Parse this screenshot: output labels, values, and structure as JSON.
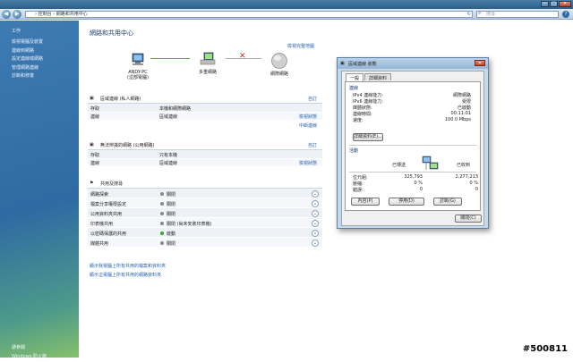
{
  "address": {
    "path": "› 控制台 › 網路和共用中心",
    "search_placeholder": "搜尋"
  },
  "sidebar": {
    "title": "工作",
    "items": [
      "檢視電腦及裝置",
      "連線到網路",
      "設定連線或網路",
      "管理網路連線",
      "診斷和修復"
    ],
    "see_also_title": "請參閱",
    "see_also": [
      "Windows 防火牆"
    ]
  },
  "main": {
    "title": "網路和共用中心",
    "full_map": "檢視完整地圖",
    "map": {
      "computer": "ANDY-PC",
      "computer_sub": "(這部電腦)",
      "network": "多重網路",
      "internet": "網際網路"
    },
    "section1": {
      "title": "區域連線 (私人網路)",
      "action": "自訂",
      "rows": [
        {
          "k": "存取",
          "v": "本機和網際網路",
          "l": ""
        },
        {
          "k": "連線",
          "v": "區域連線",
          "l": "檢視狀態"
        }
      ],
      "extra_link": "中斷連線"
    },
    "section2": {
      "title": "無法辨識的網路 (公用網路)",
      "action": "自訂",
      "rows": [
        {
          "k": "存取",
          "v": "只有本機",
          "l": ""
        },
        {
          "k": "連線",
          "v": "區域連線",
          "l": "檢視狀態"
        }
      ]
    },
    "sharing": {
      "title": "共用及搜尋",
      "rows": [
        {
          "k": "網路探索",
          "v": "關閉",
          "on": false
        },
        {
          "k": "檔案分享權限設定",
          "v": "關閉",
          "on": false
        },
        {
          "k": "公用資料夾共用",
          "v": "關閉",
          "on": false
        },
        {
          "k": "印表機共用",
          "v": "關閉 (尚未安裝印表機)",
          "on": false
        },
        {
          "k": "以密碼保護的共用",
          "v": "啟動",
          "on": true
        },
        {
          "k": "媒體共用",
          "v": "關閉",
          "on": false
        }
      ]
    },
    "links": [
      "顯示我電腦上所有共用的檔案和資料夾",
      "顯示這電腦上所有共用的網路資料夾"
    ]
  },
  "dialog": {
    "title": "區域連線 狀態",
    "tabs": [
      "一般",
      "詳細資料"
    ],
    "conn_title": "連線",
    "conn": [
      {
        "k": "IPv4 連線能力:",
        "v": "網際網路"
      },
      {
        "k": "IPv6 連線能力:",
        "v": "受限"
      },
      {
        "k": "媒體狀態:",
        "v": "已啟動"
      },
      {
        "k": "連線時間:",
        "v": "00:11:01"
      },
      {
        "k": "速度:",
        "v": "100.0 Mbps"
      }
    ],
    "details_btn": "詳細資料(E)...",
    "activity_title": "活動",
    "sent_label": "已傳送",
    "recv_label": "已收到",
    "activity": [
      {
        "k": "位元組:",
        "sent": "325,793",
        "recv": "2,277,213"
      },
      {
        "k": "壓縮:",
        "sent": "0 %",
        "recv": "0 %"
      },
      {
        "k": "錯誤:",
        "sent": "0",
        "recv": "0"
      }
    ],
    "buttons": [
      "內容(P)",
      "停用(D)",
      "診斷(G)"
    ],
    "close": "關閉(C)"
  },
  "watermark": "#500811"
}
